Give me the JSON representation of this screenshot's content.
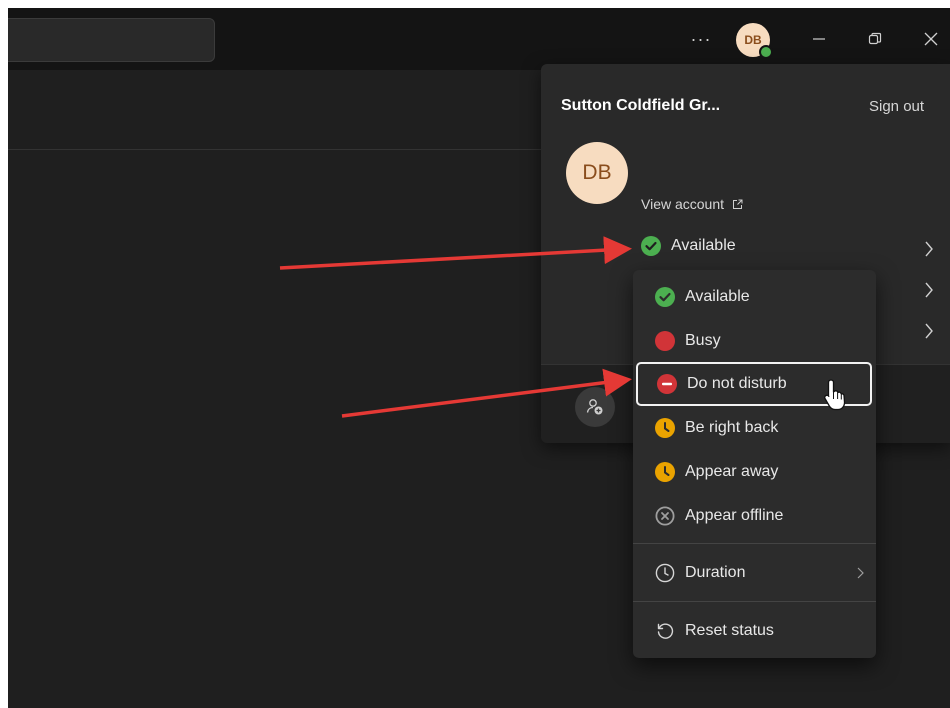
{
  "titlebar": {
    "more_label": "···",
    "avatar_initials": "DB",
    "avatar_color": "#f7dcc0"
  },
  "account_panel": {
    "org_name": "Sutton Coldfield Gr...",
    "sign_out": "Sign out",
    "avatar_initials": "DB",
    "view_account": "View account",
    "current_status": "Available"
  },
  "status_menu": {
    "items": [
      {
        "label": "Available",
        "icon": "available-check-icon",
        "color": "#4caf50"
      },
      {
        "label": "Busy",
        "icon": "busy-dot-icon",
        "color": "#d13438"
      },
      {
        "label": "Do not disturb",
        "icon": "dnd-icon",
        "color": "#d13438"
      },
      {
        "label": "Be right back",
        "icon": "clock-away-icon",
        "color": "#eaa300"
      },
      {
        "label": "Appear away",
        "icon": "clock-away-icon",
        "color": "#eaa300"
      },
      {
        "label": "Appear offline",
        "icon": "offline-x-icon",
        "color": "#9e9e9e"
      }
    ],
    "duration": "Duration",
    "reset": "Reset status"
  },
  "colors": {
    "window_bg": "#1f1f1f",
    "titlebar_bg": "#141414",
    "panel_bg": "#292929",
    "arrow": "#e53935"
  }
}
